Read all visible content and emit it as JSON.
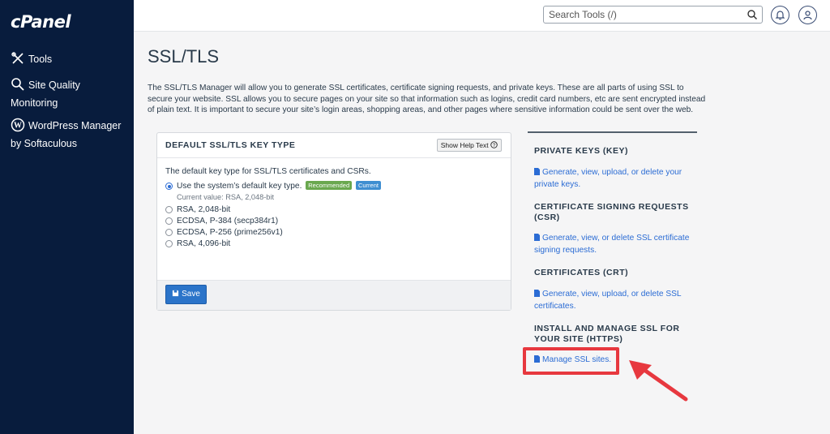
{
  "sidebar": {
    "logo": "cPanel",
    "items": [
      {
        "label": "Tools"
      },
      {
        "label": "Site Quality Monitoring",
        "line1": "Site Quality",
        "line2": "Monitoring"
      },
      {
        "label": "WordPress Manager by Softaculous",
        "line1": "WordPress Manager",
        "line2": "by Softaculous"
      }
    ]
  },
  "topbar": {
    "search_placeholder": "Search Tools (/)"
  },
  "page": {
    "title": "SSL/TLS",
    "intro": "The SSL/TLS Manager will allow you to generate SSL certificates, certificate signing requests, and private keys. These are all parts of using SSL to secure your website. SSL allows you to secure pages on your site so that information such as logins, credit card numbers, etc are sent encrypted instead of plain text. It is important to secure your site’s login areas, shopping areas, and other pages where sensitive information could be sent over the web."
  },
  "panel": {
    "title": "DEFAULT SSL/TLS KEY TYPE",
    "help_label": "Show Help Text",
    "lead": "The default key type for SSL/TLS certificates and CSRs.",
    "options": [
      {
        "label": "Use the system’s default key type.",
        "checked": true
      },
      {
        "label": "RSA, 2,048-bit",
        "checked": false
      },
      {
        "label": "ECDSA, P-384 (secp384r1)",
        "checked": false
      },
      {
        "label": "ECDSA, P-256 (prime256v1)",
        "checked": false
      },
      {
        "label": "RSA, 4,096-bit",
        "checked": false
      }
    ],
    "badge_recommended": "Recommended",
    "badge_current": "Current",
    "current_value": "Current value: RSA, 2,048-bit",
    "save_label": "Save"
  },
  "right": {
    "sections": [
      {
        "title": "PRIVATE KEYS (KEY)",
        "link": "Generate, view, upload, or delete your private keys."
      },
      {
        "title": "CERTIFICATE SIGNING REQUESTS (CSR)",
        "link": "Generate, view, or delete SSL certificate signing requests."
      },
      {
        "title": "CERTIFICATES (CRT)",
        "link": "Generate, view, upload, or delete SSL certificates."
      },
      {
        "title": "INSTALL AND MANAGE SSL FOR YOUR SITE (HTTPS)",
        "link": "Manage SSL sites."
      }
    ]
  },
  "colors": {
    "sidebar_bg": "#081c3d",
    "link": "#2b6cd4",
    "highlight": "#e7383f",
    "save_button": "#2b74c9"
  }
}
